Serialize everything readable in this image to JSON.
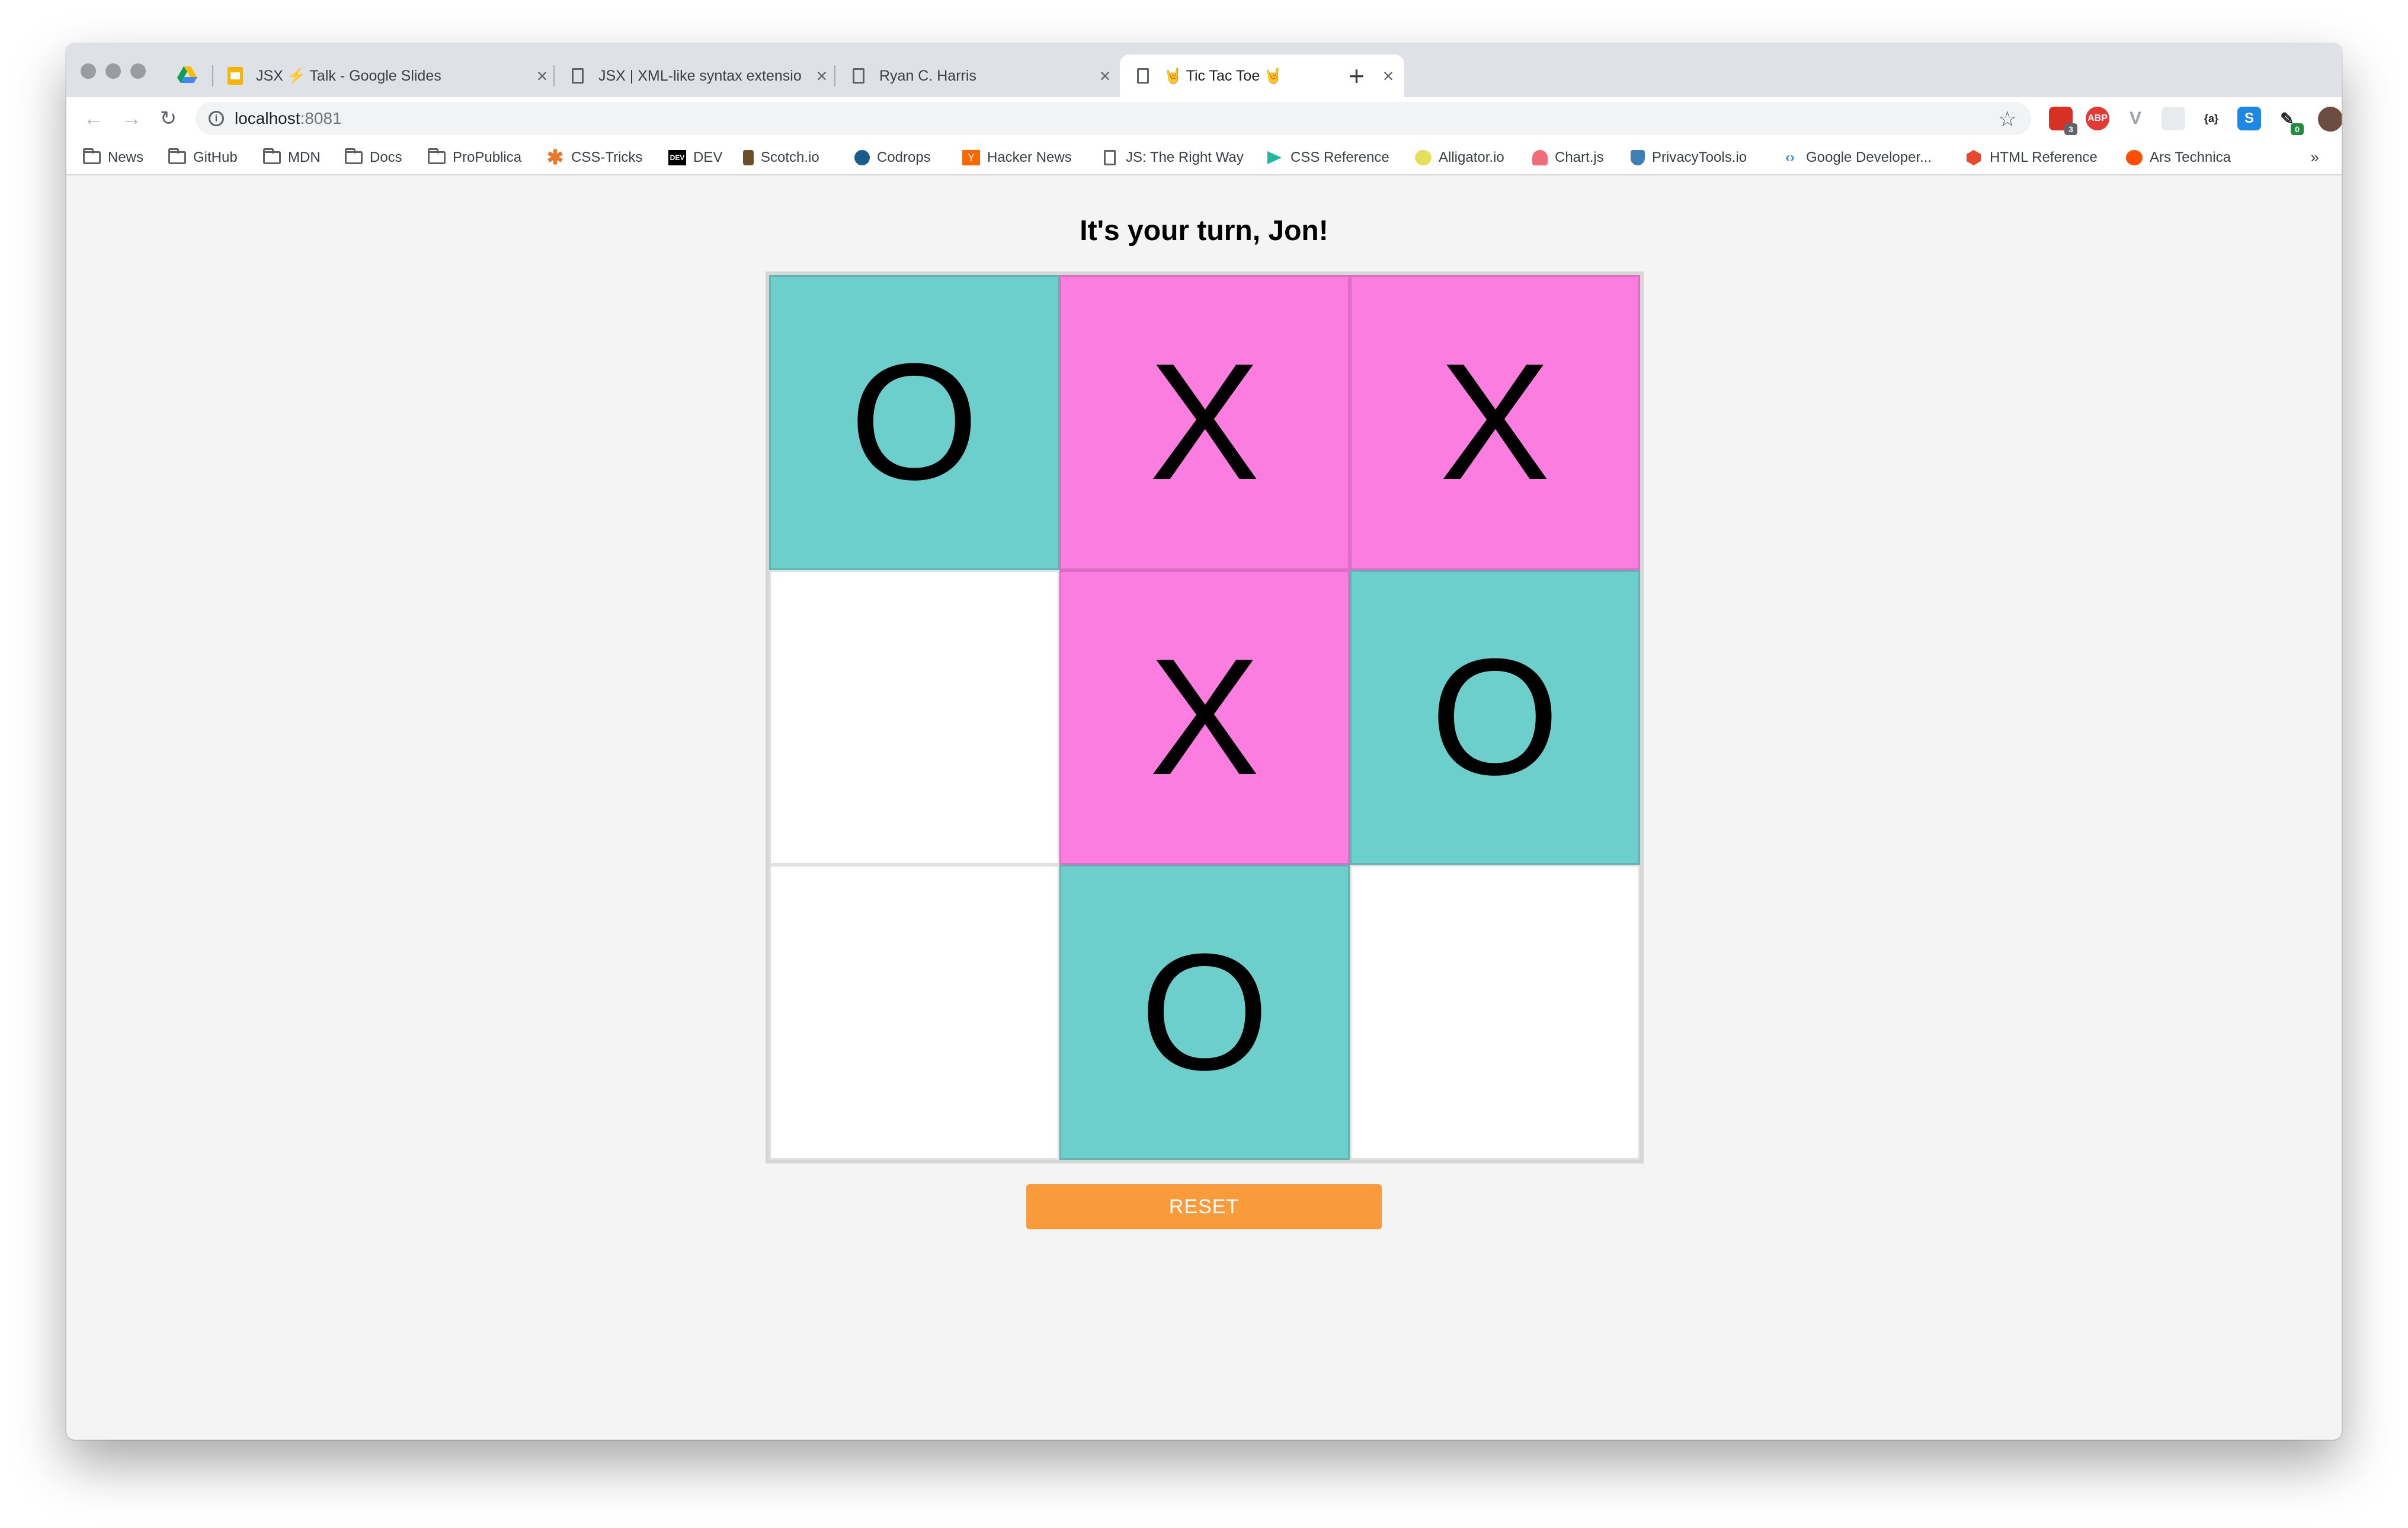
{
  "browser": {
    "tabs": [
      {
        "title": "",
        "icon": "google-drive-icon"
      },
      {
        "title": "JSX ⚡ Talk - Google Slides",
        "icon": "google-slides-icon"
      },
      {
        "title": "JSX | XML-like syntax extensio",
        "icon": "page-icon"
      },
      {
        "title": "Ryan C. Harris",
        "icon": "page-icon"
      },
      {
        "title": "🤘 Tic Tac Toe 🤘",
        "icon": "page-icon",
        "active": true
      }
    ],
    "address": {
      "host": "localhost",
      "port": ":8081"
    },
    "extensions": [
      {
        "label": "",
        "badge": "3",
        "color": "#d93025",
        "icon": "calendar-extension-icon"
      },
      {
        "label": "ABP",
        "badge": "",
        "color": "#e53935",
        "icon": "adblock-plus-icon"
      },
      {
        "label": "V",
        "badge": "",
        "color": "#9aa0a6",
        "icon": "vue-devtools-icon"
      },
      {
        "label": "",
        "badge": "",
        "color": "#e8eaed",
        "icon": "blank-extension-icon"
      },
      {
        "label": "{a}",
        "badge": "",
        "color": "#ffffff",
        "icon": "json-extension-icon"
      },
      {
        "label": "S",
        "badge": "",
        "color": "#1e88e5",
        "icon": "s-extension-icon"
      },
      {
        "label": "",
        "badge": "0",
        "color": "#ffffff",
        "icon": "eyedropper-extension-icon"
      }
    ],
    "bookmarks": [
      {
        "label": "News",
        "icon": "folder-icon"
      },
      {
        "label": "GitHub",
        "icon": "folder-icon"
      },
      {
        "label": "MDN",
        "icon": "folder-icon"
      },
      {
        "label": "Docs",
        "icon": "folder-icon"
      },
      {
        "label": "ProPublica",
        "icon": "folder-icon"
      },
      {
        "label": "CSS-Tricks",
        "icon": "css-tricks-icon"
      },
      {
        "label": "DEV",
        "icon": "dev-icon"
      },
      {
        "label": "Scotch.io",
        "icon": "scotch-icon"
      },
      {
        "label": "Codrops",
        "icon": "codrops-icon"
      },
      {
        "label": "Hacker News",
        "icon": "hacker-news-icon"
      },
      {
        "label": "JS: The Right Way",
        "icon": "page-icon"
      },
      {
        "label": "CSS Reference",
        "icon": "css-reference-icon"
      },
      {
        "label": "Alligator.io",
        "icon": "alligator-icon"
      },
      {
        "label": "Chart.js",
        "icon": "chartjs-icon"
      },
      {
        "label": "PrivacyTools.io",
        "icon": "privacytools-icon"
      },
      {
        "label": "Google Developer...",
        "icon": "google-developers-icon"
      },
      {
        "label": "HTML Reference",
        "icon": "html-reference-icon"
      },
      {
        "label": "Ars Technica",
        "icon": "ars-technica-icon"
      }
    ],
    "bookmarks_more": "»"
  },
  "game": {
    "status": "It's your turn, Jon!",
    "cells": [
      "O",
      "X",
      "X",
      "",
      "X",
      "O",
      "",
      "O",
      ""
    ],
    "colors": {
      "X": "#fb7ddf",
      "O": "#6dcfcc",
      "empty": "#ffffff"
    },
    "reset_label": "RESET"
  }
}
